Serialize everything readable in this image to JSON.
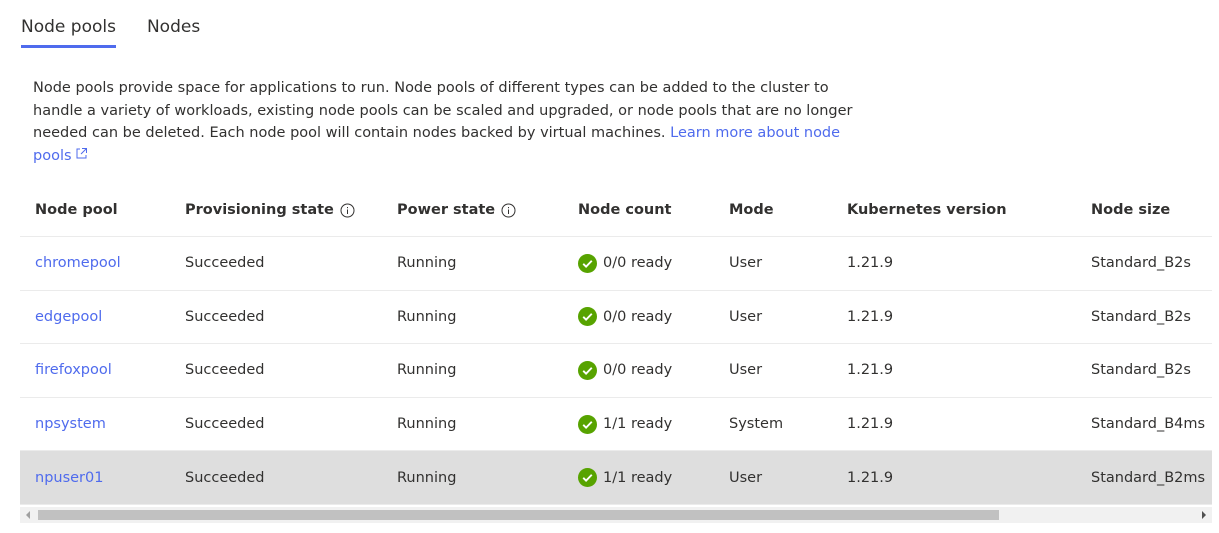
{
  "tabs": [
    {
      "label": "Node pools",
      "active": true
    },
    {
      "label": "Nodes",
      "active": false
    }
  ],
  "description": {
    "text": "Node pools provide space for applications to run. Node pools of different types can be added to the cluster to handle a variety of workloads, existing node pools can be scaled and upgraded, or node pools that are no longer needed can be deleted. Each node pool will contain nodes backed by virtual machines. ",
    "link_text": "Learn more about node pools",
    "link_icon": "external-link-icon"
  },
  "table": {
    "columns": [
      "Node pool",
      "Provisioning state",
      "Power state",
      "Node count",
      "Mode",
      "Kubernetes version",
      "Node size"
    ],
    "rows": [
      {
        "name": "chromepool",
        "provisioning": "Succeeded",
        "power": "Running",
        "count": "0/0 ready",
        "mode": "User",
        "version": "1.21.9",
        "size": "Standard_B2s"
      },
      {
        "name": "edgepool",
        "provisioning": "Succeeded",
        "power": "Running",
        "count": "0/0 ready",
        "mode": "User",
        "version": "1.21.9",
        "size": "Standard_B2s"
      },
      {
        "name": "firefoxpool",
        "provisioning": "Succeeded",
        "power": "Running",
        "count": "0/0 ready",
        "mode": "User",
        "version": "1.21.9",
        "size": "Standard_B2s"
      },
      {
        "name": "npsystem",
        "provisioning": "Succeeded",
        "power": "Running",
        "count": "1/1 ready",
        "mode": "System",
        "version": "1.21.9",
        "size": "Standard_B4ms"
      },
      {
        "name": "npuser01",
        "provisioning": "Succeeded",
        "power": "Running",
        "count": "1/1 ready",
        "mode": "User",
        "version": "1.21.9",
        "size": "Standard_B2ms"
      }
    ],
    "selected_row": 4
  },
  "colors": {
    "accent": "#4f6bed",
    "success": "#57a300",
    "selected_row": "#dedede"
  }
}
